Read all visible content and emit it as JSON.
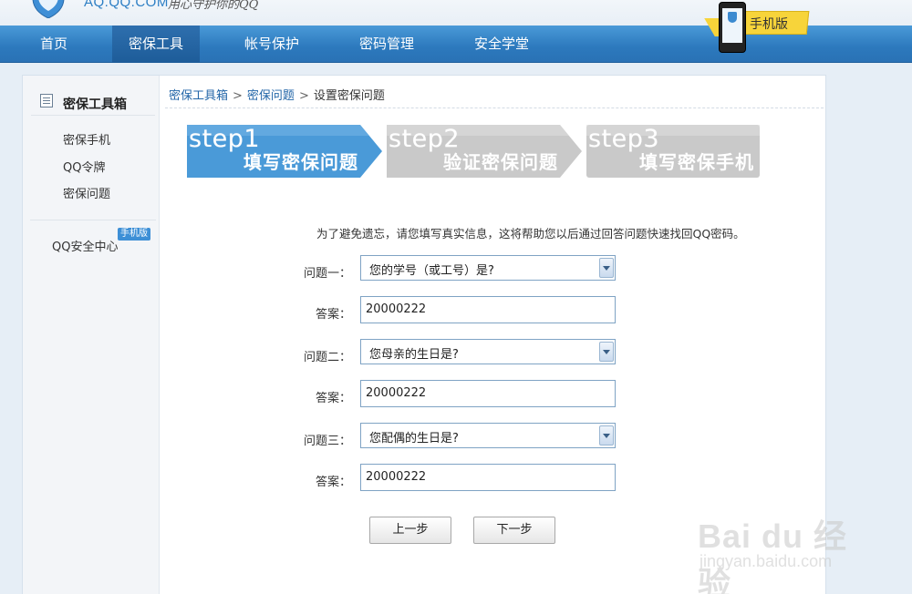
{
  "header": {
    "logo_text": "AQ.QQ.COM",
    "slogan": "用心守护你的QQ",
    "mobile_label": "手机版"
  },
  "nav": {
    "items": [
      {
        "label": "首页"
      },
      {
        "label": "密保工具"
      },
      {
        "label": "帐号保护"
      },
      {
        "label": "密码管理"
      },
      {
        "label": "安全学堂"
      }
    ],
    "active": "密保工具"
  },
  "sidebar": {
    "title": "密保工具箱",
    "links": [
      {
        "label": "密保手机"
      },
      {
        "label": "QQ令牌"
      },
      {
        "label": "密保问题"
      }
    ],
    "center_label": "QQ安全中心",
    "center_badge": "手机版"
  },
  "breadcrumb": {
    "items": [
      "密保工具箱",
      "密保问题",
      "设置密保问题"
    ],
    "separator": ">"
  },
  "steps": [
    {
      "num": "step1",
      "title": "填写密保问题",
      "state": "active"
    },
    {
      "num": "step2",
      "title": "验证密保问题",
      "state": "inactive"
    },
    {
      "num": "step3",
      "title": "填写密保手机",
      "state": "inactive"
    }
  ],
  "form": {
    "intro": "为了避免遗忘，请您填写真实信息，这将帮助您以后通过回答问题快速找回QQ密码。",
    "questions": [
      {
        "label": "问题一：",
        "selected": "您的学号（或工号）是?",
        "answer_label": "答案：",
        "answer": "20000222"
      },
      {
        "label": "问题二：",
        "selected": "您母亲的生日是?",
        "answer_label": "答案：",
        "answer": "20000222"
      },
      {
        "label": "问题三：",
        "selected": "您配偶的生日是?",
        "answer_label": "答案：",
        "answer": "20000222"
      }
    ],
    "prev_button": "上一步",
    "next_button": "下一步"
  },
  "watermark": {
    "brand": "Bai du 经验",
    "site": "jingyan.baidu.com"
  },
  "colors": {
    "nav_bg": "#2c79bd",
    "step_active": "#4a9ad8",
    "step_inactive": "#c9c9c9",
    "link": "#2366a8"
  }
}
